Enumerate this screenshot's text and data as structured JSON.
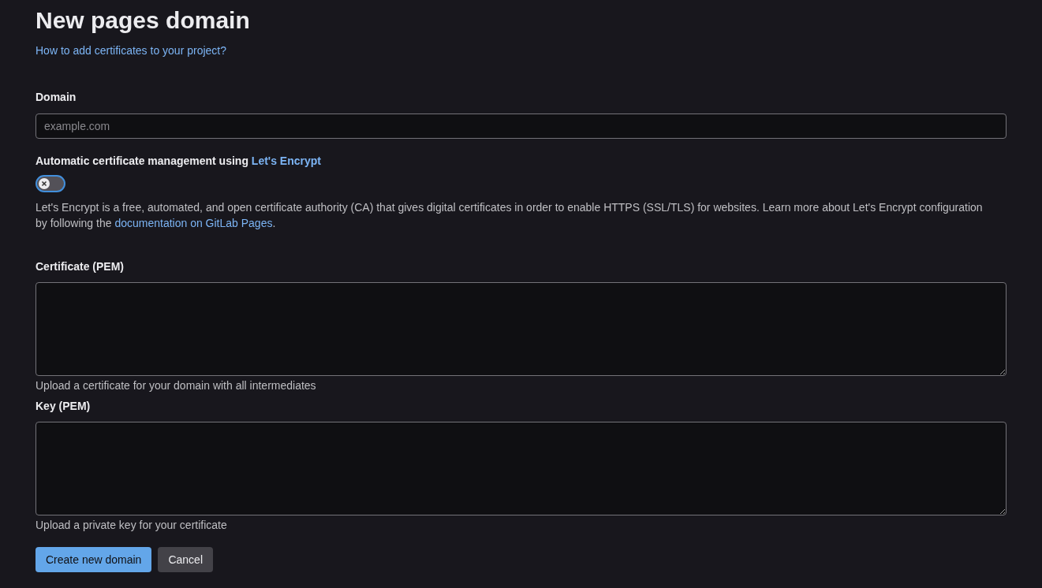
{
  "title": "New pages domain",
  "help_link": "How to add certificates to your project?",
  "domain": {
    "label": "Domain",
    "placeholder": "example.com"
  },
  "auto_cert": {
    "label": "Automatic certificate management using ",
    "label_link": "Let's Encrypt",
    "on": false,
    "description": "Let's Encrypt is a free, automated, and open certificate authority (CA) that gives digital certificates in order to enable HTTPS (SSL/TLS) for websites. Learn more about Let's Encrypt configuration by following the ",
    "description_link": "documentation on GitLab Pages",
    "description_end": "."
  },
  "fields": [
    {
      "label": "Certificate (PEM)",
      "help": "Upload a certificate for your domain with all intermediates"
    },
    {
      "label": "Key (PEM)",
      "help": "Upload a private key for your certificate"
    }
  ],
  "buttons": [
    {
      "label": "Create new domain",
      "kind": "primary"
    },
    {
      "label": "Cancel",
      "kind": "secondary"
    }
  ]
}
